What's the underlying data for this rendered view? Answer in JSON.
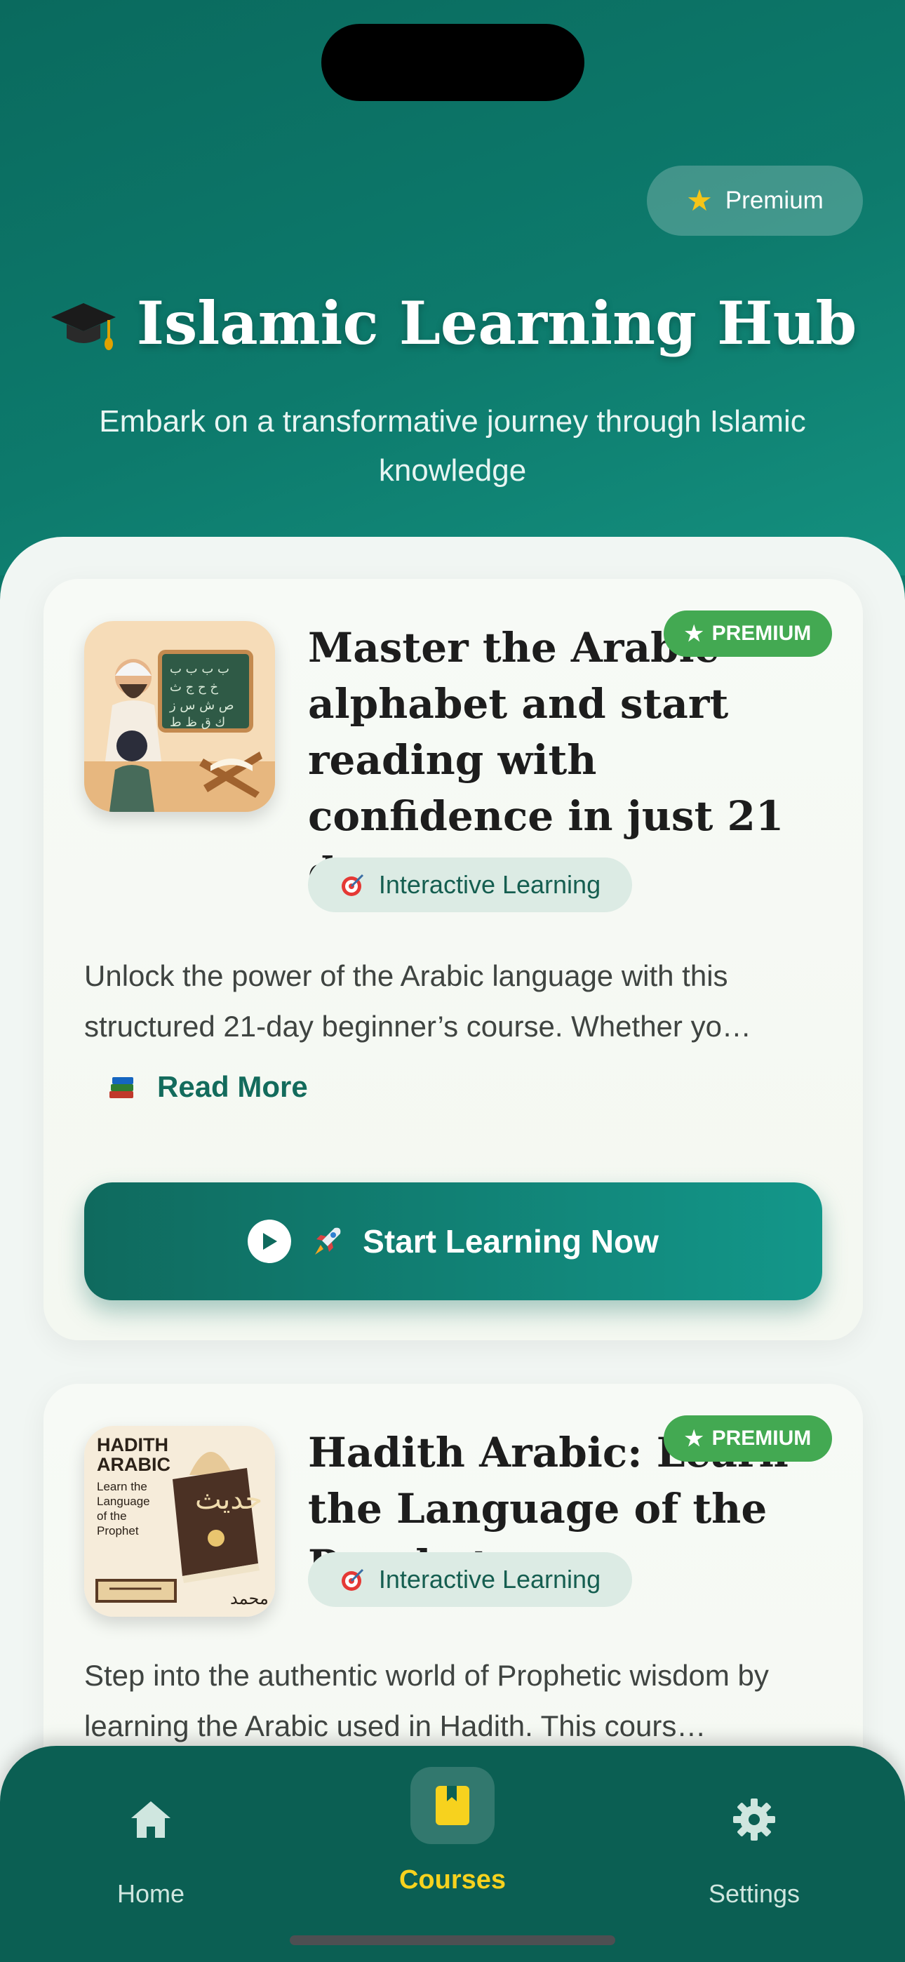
{
  "header": {
    "premium_label": "Premium",
    "title": "Islamic Learning Hub",
    "subtitle": "Embark on a transformative journey through Islamic knowledge"
  },
  "courses": [
    {
      "title": "Master the Arabic alphabet and start reading with confidence in just 21 days.",
      "badge": "PREMIUM",
      "tag": "Interactive Learning",
      "description": "Unlock the power of the Arabic language with this structured 21-day beginner’s course. Whether yo…",
      "read_more": "Read More",
      "cta": "Start Learning Now"
    },
    {
      "title": "Hadith Arabic: Learn the Language of the Prophet",
      "badge": "PREMIUM",
      "tag": "Interactive Learning",
      "description": "Step into the authentic world of Prophetic wisdom by learning the Arabic used in Hadith. This cours…",
      "thumb_text": {
        "heading": "HADITH ARABIC",
        "sub": "Learn the Language of the Prophet",
        "book_word": "حديث",
        "signature": "محمد"
      }
    }
  ],
  "nav": {
    "items": [
      {
        "label": "Home",
        "icon": "home-icon"
      },
      {
        "label": "Courses",
        "icon": "book-icon",
        "active": true
      },
      {
        "label": "Settings",
        "icon": "gear-icon"
      }
    ],
    "active_color": "#f7d21e"
  }
}
